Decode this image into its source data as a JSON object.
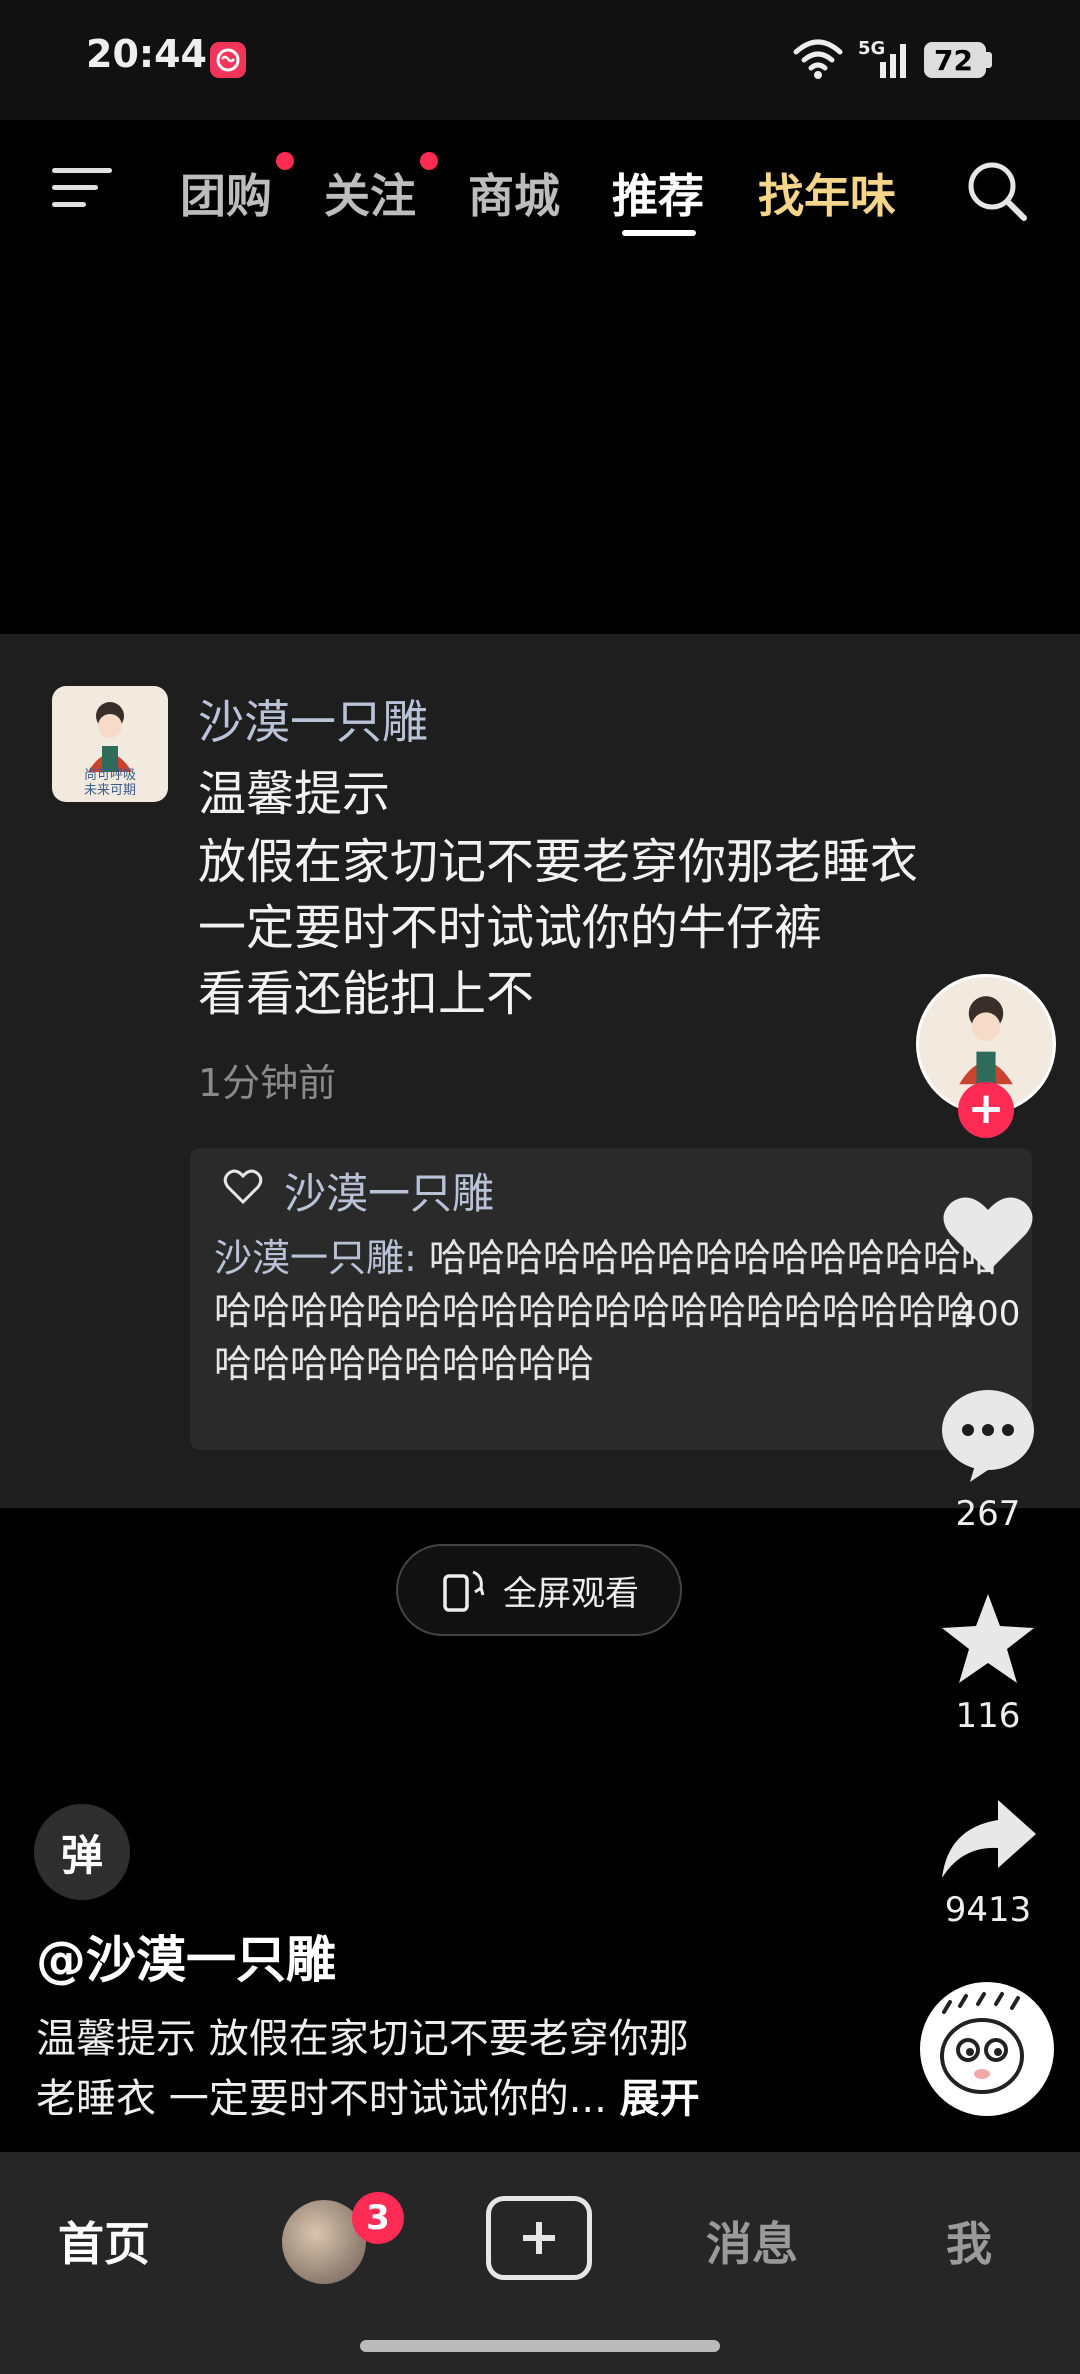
{
  "status_bar": {
    "time": "20:44",
    "network": "5G",
    "battery": "72"
  },
  "top_nav": {
    "tabs": [
      {
        "label": "团购",
        "has_dot": true
      },
      {
        "label": "关注",
        "has_dot": true
      },
      {
        "label": "商城",
        "has_dot": false
      },
      {
        "label": "推荐",
        "active": true
      },
      {
        "label": "找年味",
        "highlight_color": "#f5d58a"
      }
    ],
    "icons": [
      "menu-icon",
      "search-icon"
    ]
  },
  "comment": {
    "username": "沙漠一只雕",
    "avatar_text": "尚可呼吸\n未来可期",
    "lines": [
      "温馨提示",
      "放假在家切记不要老穿你那老睡衣",
      "一定要时不时试试你的牛仔裤",
      "看看还能扣上不"
    ],
    "time_ago": "1分钟前",
    "reply": {
      "liker_name": "沙漠一只雕",
      "reply_name": "沙漠一只雕",
      "reply_text": "哈哈哈哈哈哈哈哈哈哈哈哈哈哈哈哈哈哈哈哈哈哈哈哈哈哈哈哈哈哈哈哈哈哈哈哈哈哈哈哈哈哈哈哈哈"
    }
  },
  "fullscreen_label": "全屏观看",
  "side_actions": {
    "like_count": "400",
    "comment_count": "267",
    "favorite_count": "116",
    "share_count": "9413"
  },
  "caption": {
    "danmu_label": "弹",
    "author": "@沙漠一只雕",
    "line1": "温馨提示 放假在家切记不要老穿你那",
    "line2": "老睡衣 一定要时不时试试你的...",
    "expand_label": "展开"
  },
  "bottom_nav": {
    "home": "首页",
    "friends_badge": "3",
    "messages": "消息",
    "me": "我"
  },
  "colors": {
    "accent": "#fe2c55",
    "highlight": "#f5d58a",
    "username": "#b9c2d6"
  }
}
